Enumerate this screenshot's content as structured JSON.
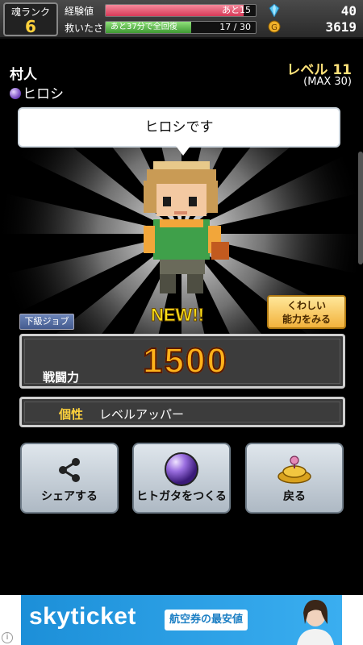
{
  "status": {
    "soul_rank_label": "魂ランク",
    "soul_rank_value": "6",
    "exp_label": "経験値",
    "exp_remaining": "あと15",
    "exp_fill": 0.92,
    "rescue_label": "救いたさ",
    "rescue_value": "17 / 30",
    "rescue_recover": "あと37分で全回復",
    "rescue_fill": 0.57,
    "gems": "40",
    "gold": "3619",
    "gem_icon": "blue-crystal-icon",
    "gold_icon": "gold-coin-icon"
  },
  "character": {
    "job": "村人",
    "name": "ヒロシ",
    "level": "レベル 11",
    "level_max": "(MAX 30)",
    "speech": "ヒロシです",
    "new_badge": "NEW!!",
    "job_class": "下級ジョブ",
    "detail_button": "くわしい\n能力をみる"
  },
  "power": {
    "label": "戦闘力",
    "value": "1500"
  },
  "trait": {
    "label": "個性",
    "value": "レベルアッパー"
  },
  "actions": [
    {
      "label": "シェアする",
      "icon": "share-icon"
    },
    {
      "label": "ヒトガタをつくる",
      "icon": "purple-orb-icon"
    },
    {
      "label": "戻る",
      "icon": "gold-pile-icon"
    }
  ],
  "ad": {
    "brand": "skyticket",
    "copy": "航空券の最安値",
    "info": "i"
  },
  "colors": {
    "accent": "#ffd23c",
    "exp_bar": "#e2546b",
    "rescue_bar": "#58b94a",
    "ad_blue": "#1c8fd8"
  }
}
